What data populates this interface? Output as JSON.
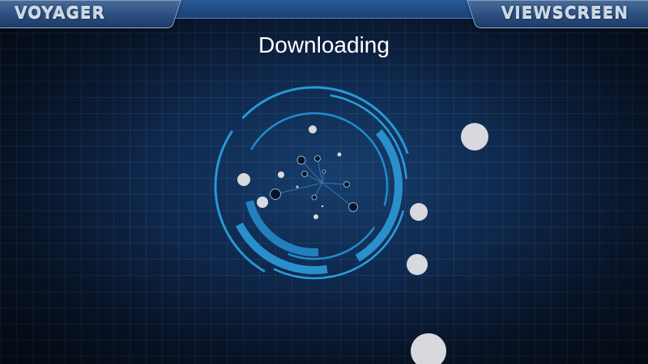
{
  "header": {
    "left_label": "VOYAGER",
    "right_label": "VIEWSCREEN"
  },
  "main": {
    "status_text": "Downloading"
  },
  "colors": {
    "ring": "#27a3e0",
    "ring_light": "#3cc0ee",
    "node_dark": "#0b1220",
    "bubble": "#d7d9de",
    "tab_text": "#c9d6e6"
  },
  "icons": {
    "loader": "download-progress-rings-icon"
  }
}
